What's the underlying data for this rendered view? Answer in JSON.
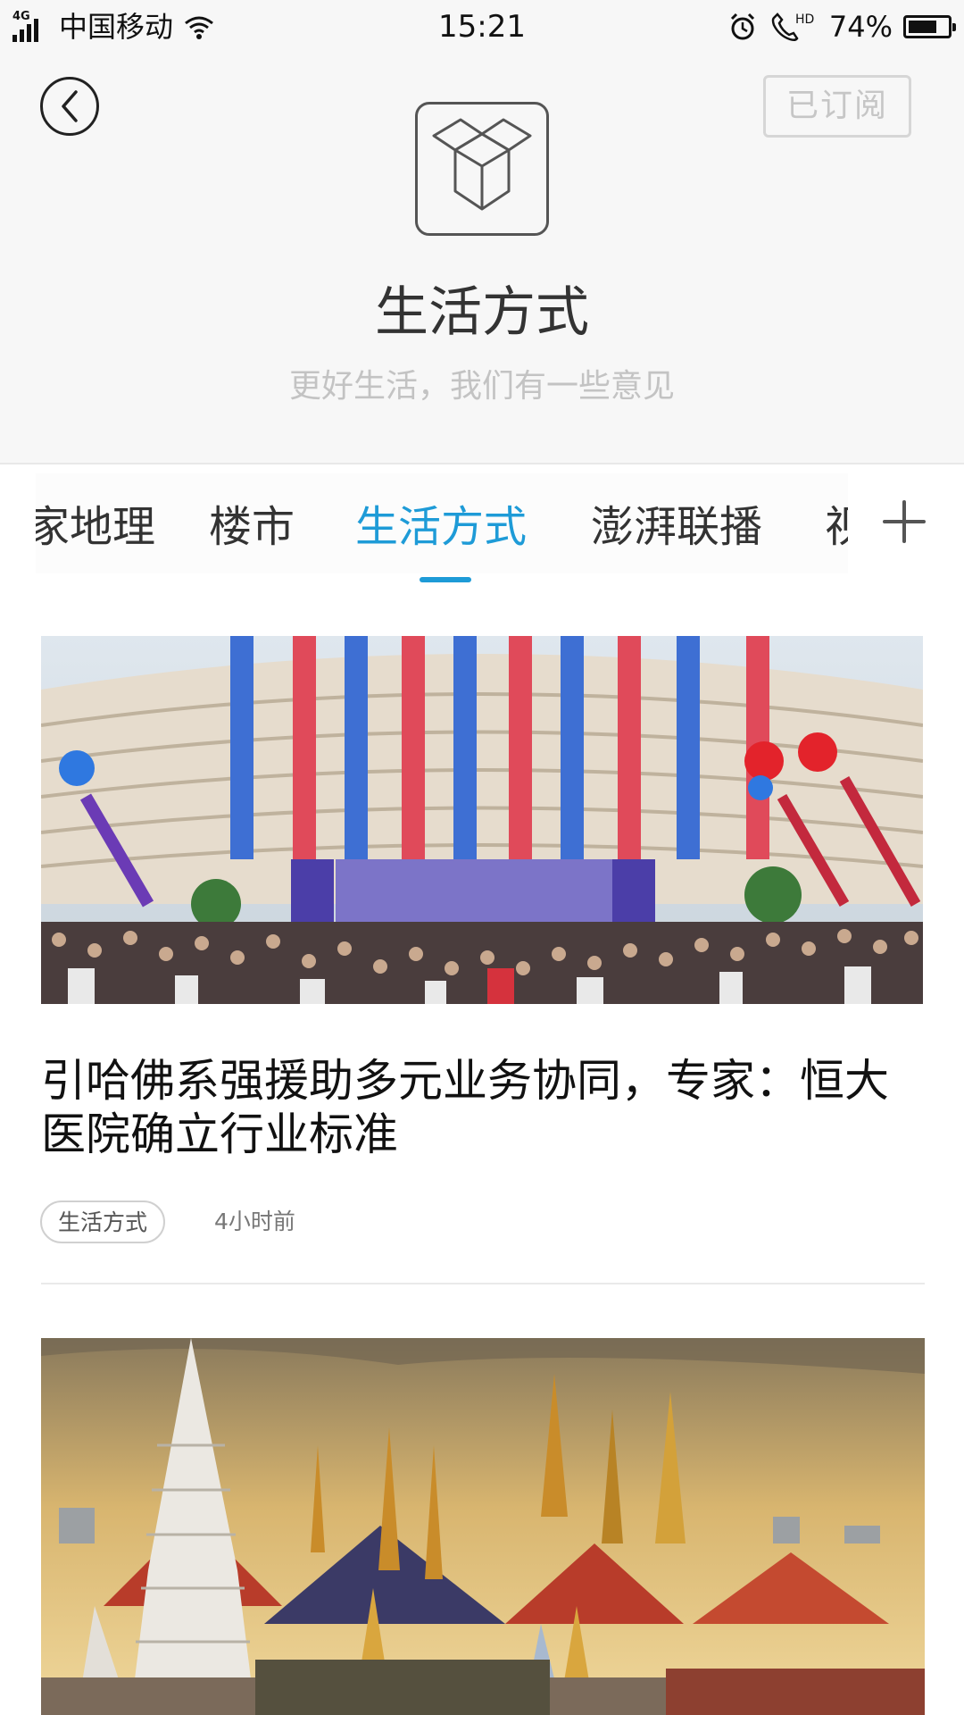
{
  "status_bar": {
    "network": "4G",
    "carrier": "中国移动",
    "time": "15:21",
    "hd_label": "HD",
    "battery_percent": "74%",
    "battery_level": 0.74
  },
  "header": {
    "subscribe_label": "已订阅",
    "channel_title": "生活方式",
    "channel_subtitle": "更好生活，我们有一些意见"
  },
  "tabs": [
    {
      "label": "家地理"
    },
    {
      "label": "楼市"
    },
    {
      "label": "生活方式",
      "active": true
    },
    {
      "label": "澎湃联播"
    },
    {
      "label": "视"
    }
  ],
  "articles": [
    {
      "title": "引哈佛系强援助多元业务协同，专家：恒大医院确立行业标准",
      "tag": "生活方式",
      "time": "4小时前"
    }
  ],
  "colors": {
    "accent": "#1e9bd7",
    "header_bg": "#f7f7f7",
    "subtitle": "#c3c3c3"
  }
}
